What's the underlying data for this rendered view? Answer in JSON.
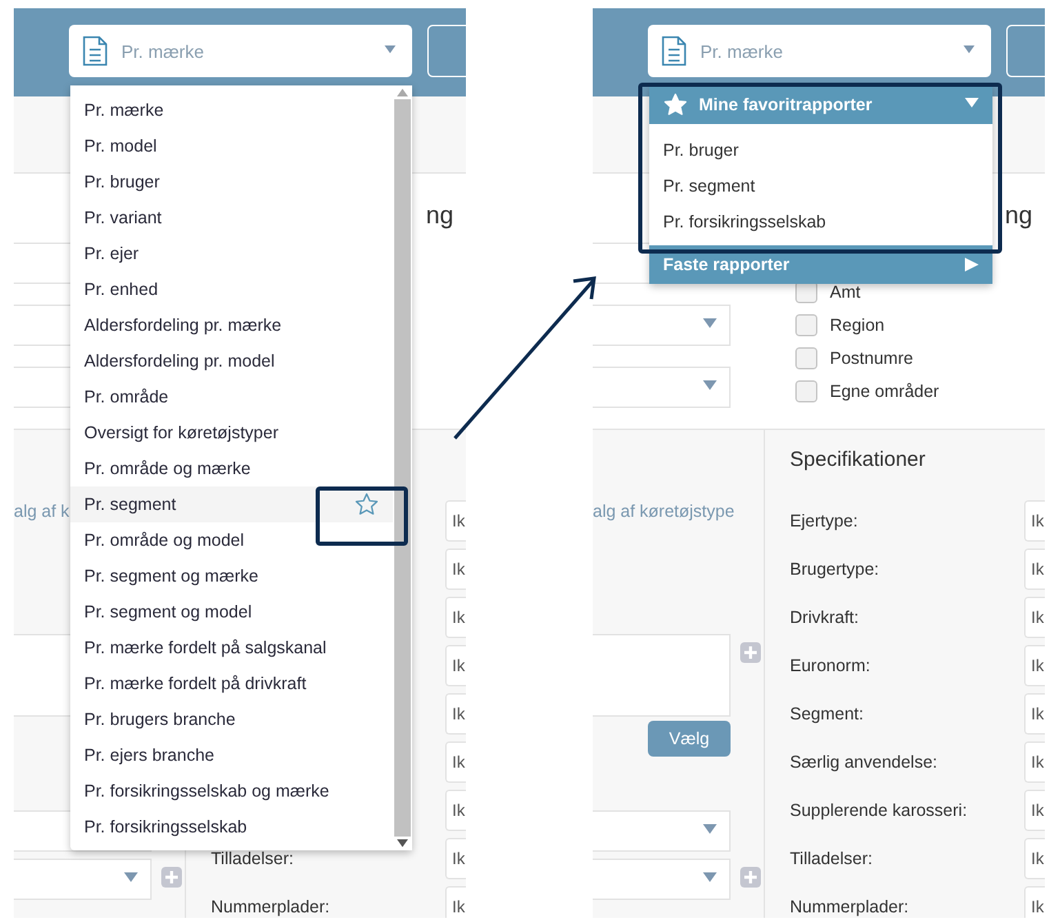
{
  "panels": [
    {
      "report_select": {
        "value": "Pr. mærke"
      },
      "heading_fragment": "ng",
      "top_fields": [
        {
          "kind": "blank"
        },
        {
          "kind": "blank"
        },
        {
          "kind": "blank"
        }
      ],
      "vehicle_type_text": "alg af k",
      "bottom_fields": [
        {
          "kind": "blank"
        },
        {
          "kind": "select",
          "plus": true
        }
      ],
      "spec_rows": [
        {
          "value": "Ik"
        },
        {
          "value": "Ik"
        },
        {
          "value": "Ik"
        },
        {
          "value": "Ik"
        },
        {
          "value": "Ik"
        },
        {
          "value": "Ik"
        },
        {
          "value": "Ik"
        },
        {
          "label": "Tilladelser:",
          "value": "Ik"
        },
        {
          "label": "Nummerplader:",
          "value": "Ik"
        }
      ],
      "dropdown": {
        "kind": "list",
        "items": [
          {
            "label": "Pr. mærke",
            "highlighted": false
          },
          {
            "label": "Pr. model",
            "highlighted": false
          },
          {
            "label": "Pr. bruger",
            "highlighted": false
          },
          {
            "label": "Pr. variant",
            "highlighted": false
          },
          {
            "label": "Pr. ejer",
            "highlighted": false
          },
          {
            "label": "Pr. enhed",
            "highlighted": false
          },
          {
            "label": "Aldersfordeling pr. mærke",
            "highlighted": false
          },
          {
            "label": "Aldersfordeling pr. model",
            "highlighted": false
          },
          {
            "label": "Pr. område",
            "highlighted": false
          },
          {
            "label": "Oversigt for køretøjstyper",
            "highlighted": false
          },
          {
            "label": "Pr. område og mærke",
            "highlighted": false
          },
          {
            "label": "Pr. segment",
            "highlighted": true
          },
          {
            "label": "Pr. område og model",
            "highlighted": false
          },
          {
            "label": "Pr. segment og mærke",
            "highlighted": false
          },
          {
            "label": "Pr. segment og model",
            "highlighted": false
          },
          {
            "label": "Pr. mærke fordelt på salgskanal",
            "highlighted": false
          },
          {
            "label": "Pr. mærke fordelt på drivkraft",
            "highlighted": false
          },
          {
            "label": "Pr. brugers branche",
            "highlighted": false
          },
          {
            "label": "Pr. ejers branche",
            "highlighted": false
          },
          {
            "label": "Pr. forsikringsselskab og mærke",
            "highlighted": false
          },
          {
            "label": "Pr. forsikringsselskab",
            "highlighted": false
          }
        ]
      }
    },
    {
      "report_select": {
        "value": "Pr. mærke"
      },
      "heading_fragment": "ng",
      "top_fields": [
        {
          "kind": "blank"
        },
        {
          "kind": "select"
        },
        {
          "kind": "select"
        }
      ],
      "checkboxes": [
        {
          "label": "Amt",
          "checked": false
        },
        {
          "label": "Region",
          "checked": false
        },
        {
          "label": "Postnumre",
          "checked": false
        },
        {
          "label": "Egne områder",
          "checked": false
        }
      ],
      "vehicle_type_text": "alg af køretøjstype",
      "textarea": {
        "plus": true
      },
      "choose_button": {
        "label": "Vælg"
      },
      "bottom_fields": [
        {
          "kind": "select",
          "plus": false
        },
        {
          "kind": "select",
          "plus": true
        }
      ],
      "spec_title": "Specifikationer",
      "spec_rows": [
        {
          "label": "Ejertype:",
          "value": "Ik"
        },
        {
          "label": "Brugertype:",
          "value": "Ik"
        },
        {
          "label": "Drivkraft:",
          "value": "Ik"
        },
        {
          "label": "Euronorm:",
          "value": "Ik"
        },
        {
          "label": "Segment:",
          "value": "Ik"
        },
        {
          "label": "Særlig anvendelse:",
          "value": "Ik"
        },
        {
          "label": "Supplerende karosseri:",
          "value": "Ik"
        },
        {
          "label": "Tilladelser:",
          "value": "Ik"
        },
        {
          "label": "Nummerplader:",
          "value": "Ik"
        }
      ],
      "dropdown": {
        "kind": "favorites",
        "sections": [
          {
            "title": "Mine favoritrapporter",
            "expanded": true,
            "items": [
              "Pr. bruger",
              "Pr. segment",
              "Pr. forsikringsselskab"
            ]
          },
          {
            "title": "Faste rapporter",
            "expanded": false
          }
        ]
      }
    }
  ]
}
